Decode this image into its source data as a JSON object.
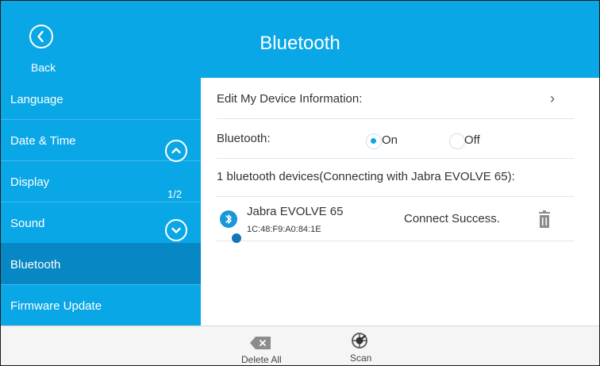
{
  "header": {
    "title": "Bluetooth",
    "back_label": "Back"
  },
  "sidebar": {
    "items": [
      {
        "label": "Language"
      },
      {
        "label": "Date & Time"
      },
      {
        "label": "Display"
      },
      {
        "label": "Sound"
      },
      {
        "label": "Bluetooth"
      },
      {
        "label": "Firmware Update"
      }
    ],
    "active_item": "Bluetooth",
    "page_indicator": "1/2"
  },
  "content": {
    "edit_label": "Edit My Device Information:",
    "bluetooth_label": "Bluetooth:",
    "on_label": "On",
    "off_label": "Off",
    "bluetooth_enabled": true,
    "devices_heading": "1 bluetooth devices(Connecting with Jabra EVOLVE 65):",
    "device": {
      "name": "Jabra EVOLVE 65",
      "mac": "1C:48:F9:A0:84:1E",
      "status": "Connect Success."
    }
  },
  "footer": {
    "delete_all": "Delete All",
    "scan": "Scan"
  },
  "colors": {
    "accent": "#0aa7e6",
    "active": "#0788c4"
  },
  "icons": [
    "back-icon",
    "chevron-up-icon",
    "chevron-down-icon",
    "chevron-right-icon",
    "bluetooth-device-icon",
    "trash-icon",
    "delete-all-icon",
    "scan-icon"
  ]
}
